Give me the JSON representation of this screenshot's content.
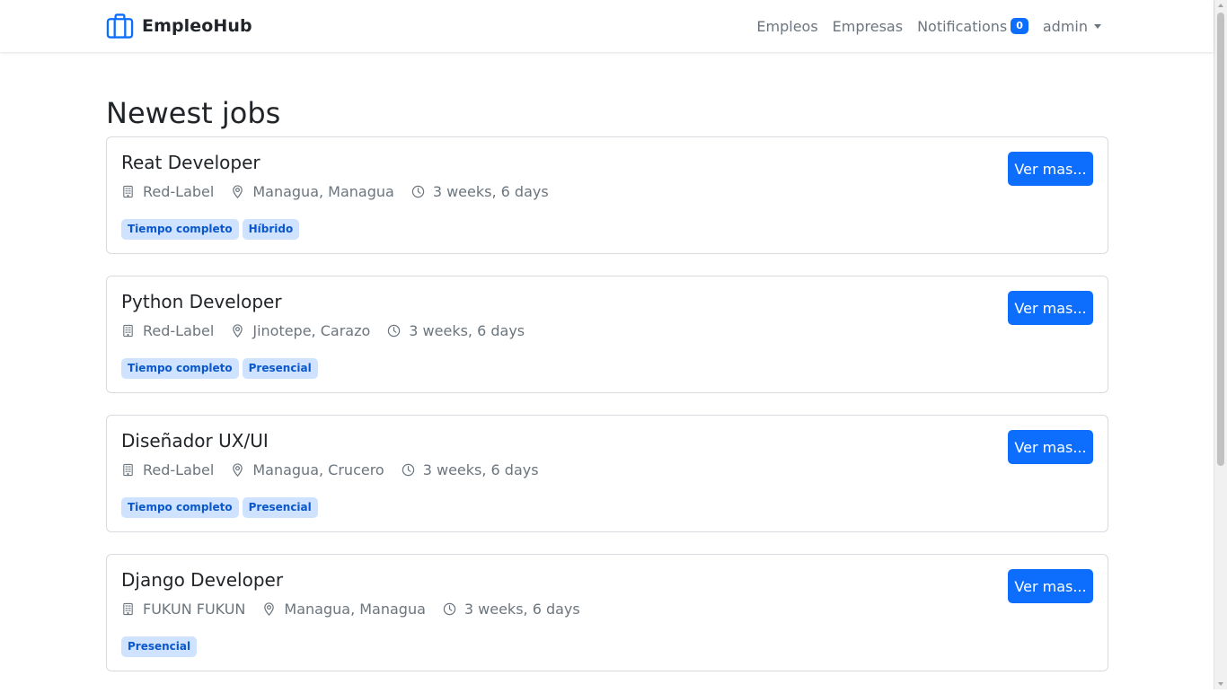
{
  "brand": {
    "name": "EmpleoHub",
    "icon": "briefcase-icon",
    "color": "#0d6efd"
  },
  "nav": {
    "links": [
      "Empleos",
      "Empresas"
    ],
    "notifications_label": "Notifications",
    "notifications_count": "0",
    "user_label": "admin"
  },
  "page_title": "Newest jobs",
  "jobs": [
    {
      "title": "Reat Developer",
      "company": "Red-Label",
      "location": "Managua, Managua",
      "posted": "3 weeks, 6 days",
      "tags": [
        "Tiempo completo",
        "Híbrido"
      ],
      "button": "Ver mas..."
    },
    {
      "title": "Python Developer",
      "company": "Red-Label",
      "location": "Jinotepe, Carazo",
      "posted": "3 weeks, 6 days",
      "tags": [
        "Tiempo completo",
        "Presencial"
      ],
      "button": "Ver mas..."
    },
    {
      "title": "Diseñador UX/UI",
      "company": "Red-Label",
      "location": "Managua, Crucero",
      "posted": "3 weeks, 6 days",
      "tags": [
        "Tiempo completo",
        "Presencial"
      ],
      "button": "Ver mas..."
    },
    {
      "title": "Django Developer",
      "company": "FUKUN FUKUN",
      "location": "Managua, Managua",
      "posted": "3 weeks, 6 days",
      "tags": [
        "Presencial"
      ],
      "button": "Ver mas..."
    }
  ],
  "colors": {
    "primary": "#0d6efd",
    "tag_bg": "#cfe2ff",
    "tag_text": "#0a58ca",
    "muted": "#6c757d"
  }
}
